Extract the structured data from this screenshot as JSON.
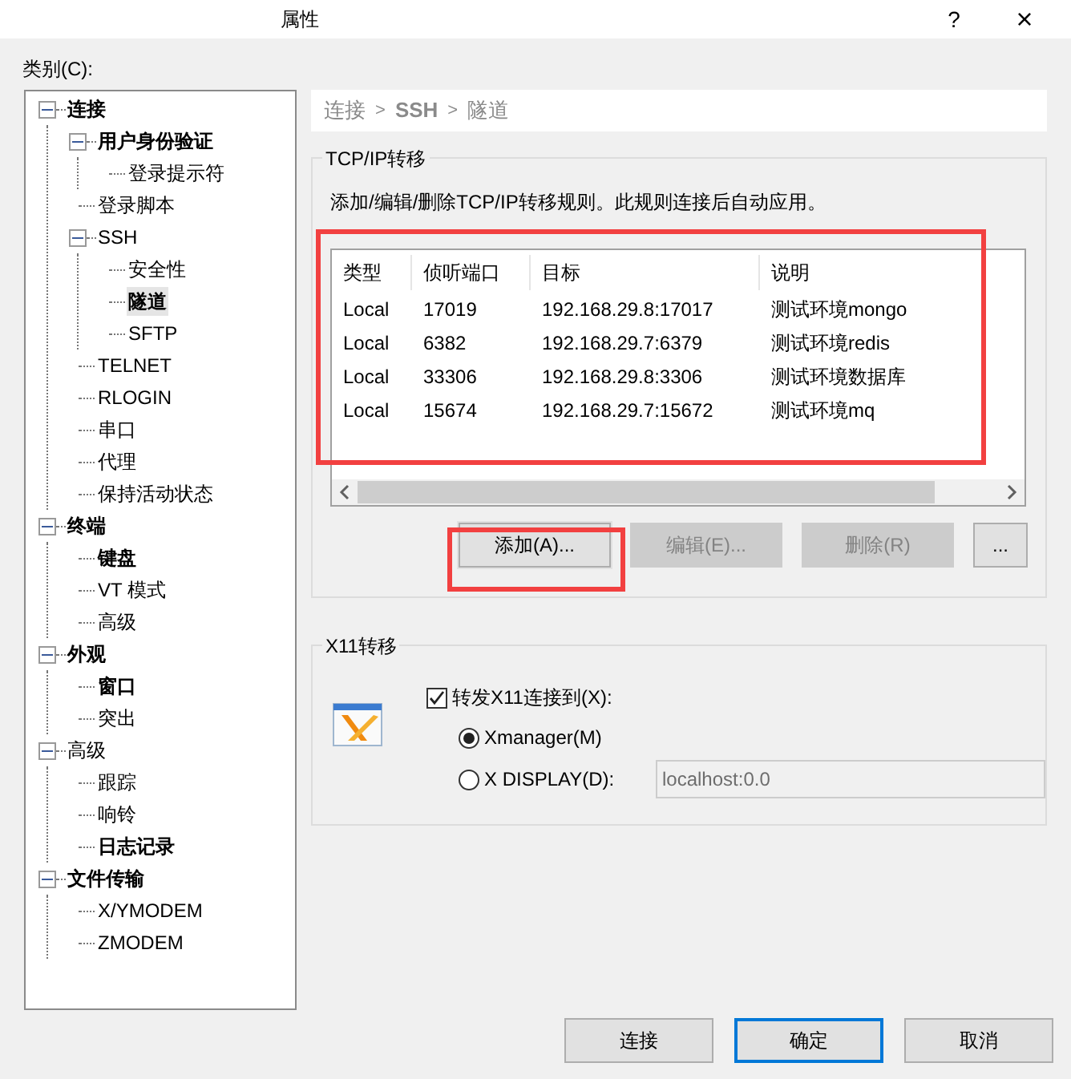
{
  "window": {
    "title": "属性",
    "help": "?",
    "close": "×"
  },
  "category_label": "类别(C):",
  "tree": [
    {
      "label": "连接",
      "bold": true,
      "selected": false,
      "expanded": true,
      "children": [
        {
          "label": "用户身份验证",
          "bold": true,
          "selected": false,
          "expanded": true,
          "children": [
            {
              "label": "登录提示符",
              "bold": false,
              "selected": false
            }
          ]
        },
        {
          "label": "登录脚本",
          "bold": false,
          "selected": false
        },
        {
          "label": "SSH",
          "bold": false,
          "selected": false,
          "expanded": true,
          "children": [
            {
              "label": "安全性",
              "bold": false,
              "selected": false
            },
            {
              "label": "隧道",
              "bold": true,
              "selected": true
            },
            {
              "label": "SFTP",
              "bold": false,
              "selected": false
            }
          ]
        },
        {
          "label": "TELNET",
          "bold": false,
          "selected": false
        },
        {
          "label": "RLOGIN",
          "bold": false,
          "selected": false
        },
        {
          "label": "串口",
          "bold": false,
          "selected": false
        },
        {
          "label": "代理",
          "bold": false,
          "selected": false
        },
        {
          "label": "保持活动状态",
          "bold": false,
          "selected": false
        }
      ]
    },
    {
      "label": "终端",
      "bold": true,
      "selected": false,
      "expanded": true,
      "children": [
        {
          "label": "键盘",
          "bold": true,
          "selected": false
        },
        {
          "label": "VT 模式",
          "bold": false,
          "selected": false
        },
        {
          "label": "高级",
          "bold": false,
          "selected": false
        }
      ]
    },
    {
      "label": "外观",
      "bold": true,
      "selected": false,
      "expanded": true,
      "children": [
        {
          "label": "窗口",
          "bold": true,
          "selected": false
        },
        {
          "label": "突出",
          "bold": false,
          "selected": false
        }
      ]
    },
    {
      "label": "高级",
      "bold": false,
      "selected": false,
      "expanded": true,
      "children": [
        {
          "label": "跟踪",
          "bold": false,
          "selected": false
        },
        {
          "label": "响铃",
          "bold": false,
          "selected": false
        },
        {
          "label": "日志记录",
          "bold": true,
          "selected": false
        }
      ]
    },
    {
      "label": "文件传输",
      "bold": true,
      "selected": false,
      "expanded": true,
      "children": [
        {
          "label": "X/YMODEM",
          "bold": false,
          "selected": false
        },
        {
          "label": "ZMODEM",
          "bold": false,
          "selected": false
        }
      ]
    }
  ],
  "breadcrumb": {
    "items": [
      "连接",
      "SSH",
      "隧道"
    ],
    "separators": [
      ">",
      ">"
    ]
  },
  "tcpip": {
    "legend": "TCP/IP转移",
    "description": "添加/编辑/删除TCP/IP转移规则。此规则连接后自动应用。",
    "columns": [
      "类型",
      "侦听端口",
      "目标",
      "说明"
    ],
    "rows": [
      [
        "Local",
        "17019",
        "192.168.29.8:17017",
        "测试环境mongo"
      ],
      [
        "Local",
        "6382",
        "192.168.29.7:6379",
        "测试环境redis"
      ],
      [
        "Local",
        "33306",
        "192.168.29.8:3306",
        "测试环境数据库"
      ],
      [
        "Local",
        "15674",
        "192.168.29.7:15672",
        "测试环境mq"
      ]
    ],
    "buttons": [
      {
        "label": "添加(A)...",
        "disabled": false,
        "highlighted": true
      },
      {
        "label": "编辑(E)...",
        "disabled": true,
        "highlighted": false
      },
      {
        "label": "删除(R)",
        "disabled": true,
        "highlighted": false
      },
      {
        "label": "...",
        "disabled": false,
        "highlighted": false
      }
    ]
  },
  "x11": {
    "legend": "X11转移",
    "forward": {
      "label": "转发X11连接到(X):",
      "checked": true
    },
    "options": [
      {
        "label": "Xmanager(M)",
        "selected": true
      },
      {
        "label": "X DISPLAY(D):",
        "selected": false
      }
    ],
    "display_field": {
      "value": "localhost:0.0",
      "disabled": true
    }
  },
  "footer_buttons": [
    {
      "label": "连接",
      "default": false
    },
    {
      "label": "确定",
      "default": true
    },
    {
      "label": "取消",
      "default": false
    }
  ]
}
